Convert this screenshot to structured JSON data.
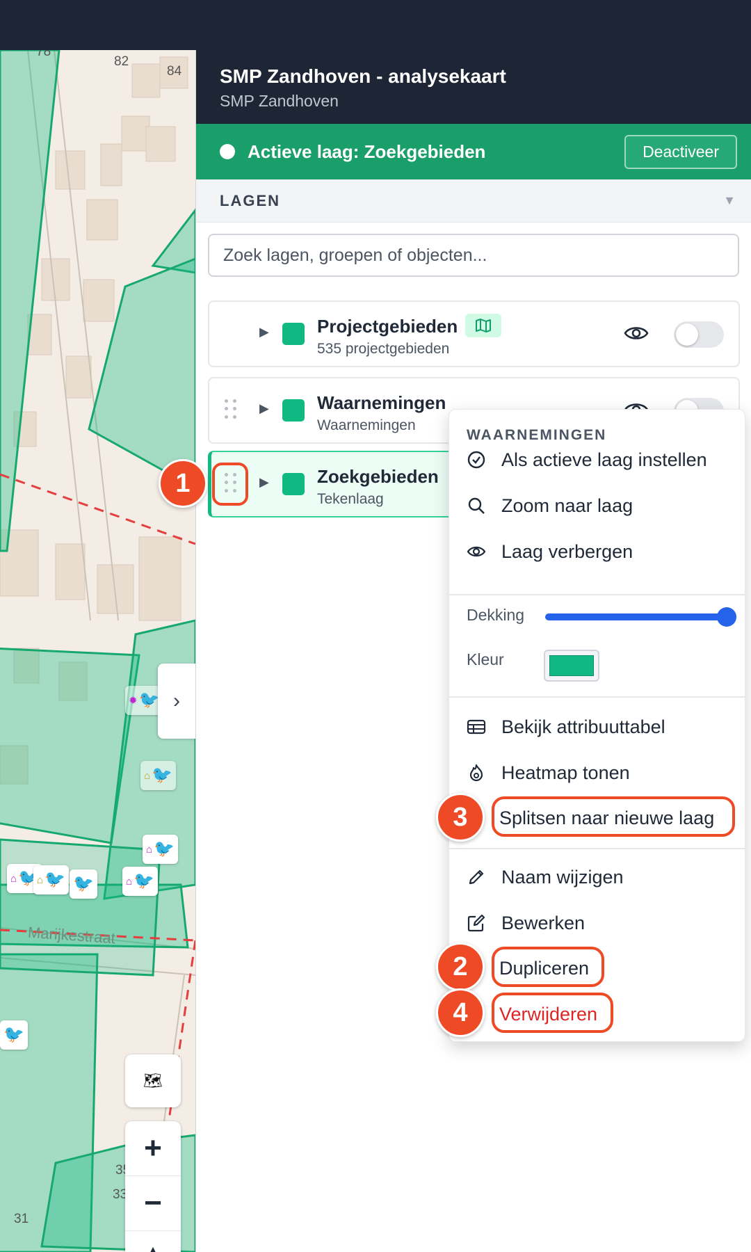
{
  "header": {
    "title": "SMP Zandhoven - analysekaart",
    "subtitle": "SMP Zandhoven"
  },
  "active_layer_bar": {
    "text": "Actieve laag: Zoekgebieden",
    "button": "Deactiveer"
  },
  "layers_section": {
    "title": "LAGEN",
    "toggle_icon": "▼",
    "search_placeholder": "Zoek lagen, groepen of objecten..."
  },
  "layers": [
    {
      "name": "Projectgebieden",
      "subtitle": "535 projectgebieden",
      "color": "#10b981",
      "visible": false,
      "has_map_badge": true
    },
    {
      "name": "Waarnemingen",
      "subtitle": "Waarnemingen",
      "color": "#10b981",
      "visible": false
    },
    {
      "name": "Zoekgebieden",
      "subtitle": "Tekenlaag",
      "color": "#10b981",
      "active": true
    }
  ],
  "context_menu": {
    "title": "WAARNEMINGEN",
    "items_top": [
      {
        "label": "Als actieve laag instellen",
        "icon": "check-circle-icon"
      },
      {
        "label": "Zoom naar laag",
        "icon": "search-icon"
      },
      {
        "label": "Laag verbergen",
        "icon": "eye-icon"
      }
    ],
    "opacity_label": "Dekking",
    "opacity_value": 1.0,
    "color_label": "Kleur",
    "color_value": "#10b981",
    "items_mid": [
      {
        "label": "Bekijk attribuuttabel",
        "icon": "table-icon"
      },
      {
        "label": "Heatmap tonen",
        "icon": "flame-icon"
      },
      {
        "label": "Splitsen naar nieuwe laag",
        "icon": ""
      }
    ],
    "items_bottom": [
      {
        "label": "Naam wijzigen",
        "icon": "pencil-icon"
      },
      {
        "label": "Bewerken",
        "icon": "edit-square-icon"
      },
      {
        "label": "Dupliceren",
        "icon": ""
      },
      {
        "label": "Verwijderen",
        "icon": "",
        "danger": true
      }
    ]
  },
  "callouts": [
    "1",
    "2",
    "3",
    "4"
  ],
  "map": {
    "labels": [
      "78",
      "82",
      "84",
      "Marijkestraat",
      "35",
      "33",
      "31"
    ],
    "controls": {
      "zoom_in": "+",
      "zoom_out": "−",
      "compass": "▲▼",
      "collapse": "›"
    }
  },
  "colors": {
    "header_bg": "#1e2535",
    "active_bar": "#1a9e6a",
    "accent_green": "#10b981",
    "callout": "#ee4a26",
    "danger": "#dc2626",
    "slider": "#2563eb"
  }
}
